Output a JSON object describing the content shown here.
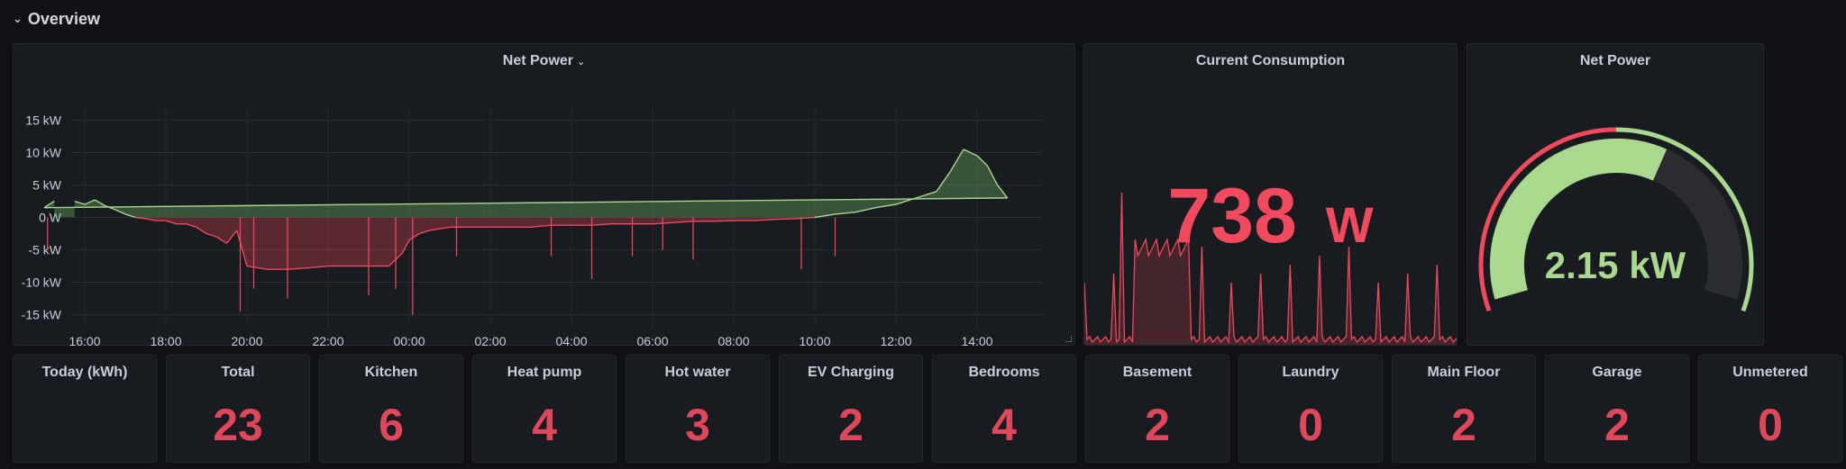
{
  "row": {
    "title": "Overview"
  },
  "net_power_panel": {
    "title": "Net Power",
    "y_ticks": [
      "15 kW",
      "10 kW",
      "5 kW",
      "0 W",
      "-5 kW",
      "-10 kW",
      "-15 kW"
    ],
    "x_ticks": [
      "16:00",
      "18:00",
      "20:00",
      "22:00",
      "00:00",
      "02:00",
      "04:00",
      "06:00",
      "08:00",
      "10:00",
      "12:00",
      "14:00"
    ]
  },
  "current_consumption_panel": {
    "title": "Current Consumption",
    "value": "738",
    "unit": "W"
  },
  "net_power_gauge": {
    "title": "Net Power",
    "value_text": "2.15 kW",
    "min": -10,
    "max": 10,
    "value": 2.15,
    "threshold_color_low": "#f2495c",
    "threshold_color_high": "#a8d98c"
  },
  "stats_label": {
    "title": "Today (kWh)"
  },
  "stats": [
    {
      "title": "Total",
      "value": "23"
    },
    {
      "title": "Kitchen",
      "value": "6"
    },
    {
      "title": "Heat pump",
      "value": "4"
    },
    {
      "title": "Hot water",
      "value": "3"
    },
    {
      "title": "EV Charging",
      "value": "2"
    },
    {
      "title": "Bedrooms",
      "value": "4"
    },
    {
      "title": "Basement",
      "value": "2"
    },
    {
      "title": "Laundry",
      "value": "0"
    },
    {
      "title": "Main Floor",
      "value": "2"
    },
    {
      "title": "Garage",
      "value": "2"
    },
    {
      "title": "Unmetered",
      "value": "0"
    }
  ],
  "colors": {
    "positive": "#a8d98c",
    "negative": "#f2495c",
    "panel_bg": "#181b1f",
    "page_bg": "#111217"
  },
  "chart_data": {
    "type": "area",
    "title": "Net Power",
    "ylabel": "",
    "xlabel": "",
    "y_unit": "kW",
    "ylim": [
      -17,
      17
    ],
    "x": [
      "15:45",
      "16:00",
      "16:15",
      "16:30",
      "16:45",
      "17:00",
      "17:15",
      "17:30",
      "17:45",
      "18:00",
      "18:15",
      "18:30",
      "18:45",
      "19:00",
      "19:15",
      "19:30",
      "19:45",
      "20:00",
      "20:30",
      "21:00",
      "21:30",
      "22:00",
      "22:30",
      "23:00",
      "23:30",
      "23:50",
      "00:00",
      "00:15",
      "00:30",
      "01:00",
      "01:30",
      "02:00",
      "02:30",
      "03:00",
      "03:30",
      "04:00",
      "04:30",
      "05:00",
      "05:30",
      "06:00",
      "06:30",
      "07:00",
      "07:30",
      "08:00",
      "08:30",
      "09:00",
      "09:30",
      "10:00",
      "10:30",
      "11:00",
      "11:30",
      "12:00",
      "12:30",
      "13:00",
      "13:20",
      "13:40",
      "14:00",
      "14:15",
      "14:30",
      "14:45",
      "15:00",
      "15:15"
    ],
    "series": [
      {
        "values": [
          2.5,
          2.0,
          2.7,
          1.8,
          1.2,
          0.5,
          0.0,
          -0.2,
          -0.5,
          -0.5,
          -1.0,
          -1.0,
          -1.5,
          -2.5,
          -3.0,
          -4.0,
          -2.0,
          -7.5,
          -8.0,
          -8.0,
          -7.8,
          -7.5,
          -7.5,
          -7.5,
          -7.5,
          -5.5,
          -3.5,
          -2.5,
          -2.0,
          -1.5,
          -1.5,
          -1.5,
          -1.5,
          -1.5,
          -1.2,
          -1.2,
          -1.2,
          -1.0,
          -1.0,
          -1.0,
          -0.8,
          -0.6,
          -0.6,
          -0.5,
          -0.5,
          -0.3,
          -0.2,
          0.0,
          0.5,
          0.8,
          1.5,
          2.0,
          3.0,
          4.0,
          7.0,
          10.5,
          9.5,
          8.0,
          5.0,
          3.0,
          1.5,
          2.5
        ]
      }
    ]
  }
}
